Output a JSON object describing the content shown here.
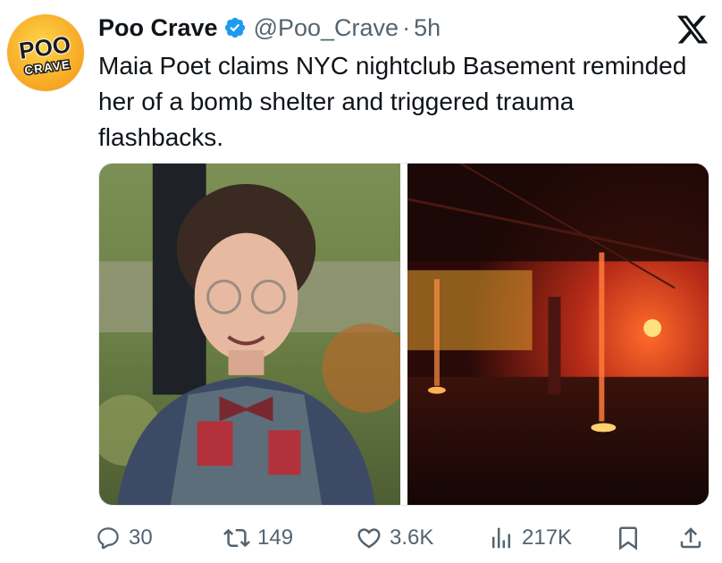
{
  "account": {
    "name": "Poo Crave",
    "handle": "@Poo_Crave",
    "separator": "·",
    "time": "5h",
    "avatar_text_top": "POO",
    "avatar_text_bottom": "CRAVE"
  },
  "tweet": {
    "text": "Maia Poet claims NYC nightclub Basement reminded her of a bomb shelter and triggered trauma flashbacks."
  },
  "media": [
    {
      "alt": "person-portrait"
    },
    {
      "alt": "red-lit-basement"
    }
  ],
  "actions": {
    "replies": "30",
    "reposts": "149",
    "likes": "3.6K",
    "views": "217K"
  },
  "icons": [
    "verified-badge-icon",
    "x-logo-icon",
    "reply-icon",
    "repost-icon",
    "like-icon",
    "views-icon",
    "bookmark-icon",
    "share-icon"
  ],
  "colors": {
    "text": "#0f1419",
    "muted": "#536471",
    "verified": "#1d9bf0",
    "avatar": "#f6a623"
  }
}
